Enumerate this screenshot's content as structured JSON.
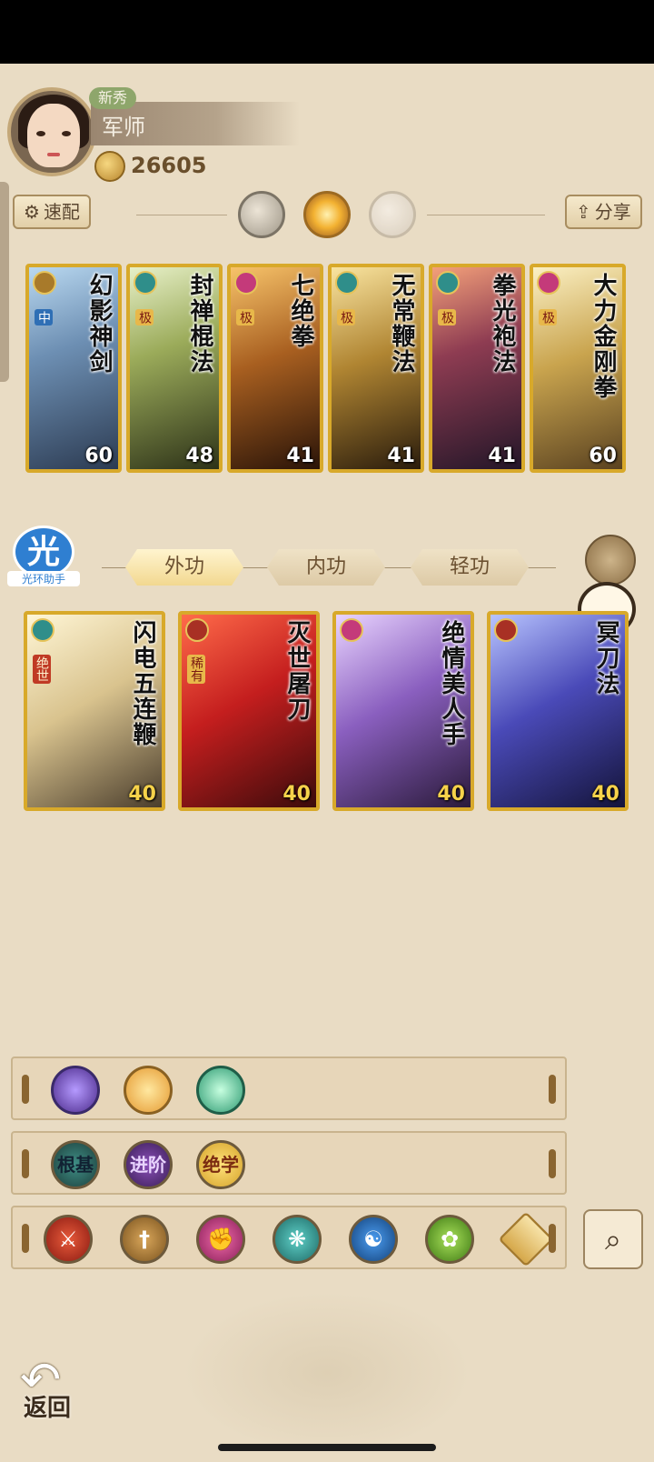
{
  "player": {
    "rank_tag": "新秀",
    "name": "军师",
    "coins": "26605"
  },
  "toolbar": {
    "quick_config_label": "速配",
    "share_label": "分享"
  },
  "equipped_skills": [
    {
      "title": "幻影神剑",
      "level": "60",
      "grade": "中"
    },
    {
      "title": "封禅棍法",
      "level": "48",
      "grade": "极"
    },
    {
      "title": "七绝拳",
      "level": "41",
      "grade": "极"
    },
    {
      "title": "无常鞭法",
      "level": "41",
      "grade": "极"
    },
    {
      "title": "拳光袍法",
      "level": "41",
      "grade": "极"
    },
    {
      "title": "大力金刚拳",
      "level": "60",
      "grade": "极"
    }
  ],
  "helper": {
    "badge": "光",
    "label": "光环助手"
  },
  "categories": {
    "tabs": [
      "外功",
      "内功",
      "轻功"
    ],
    "active": "外功"
  },
  "skill_list": [
    {
      "title": "闪电五连鞭",
      "level": "40",
      "grade": "绝世"
    },
    {
      "title": "灭世屠刀",
      "level": "40",
      "grade": "稀有"
    },
    {
      "title": "绝情美人手",
      "level": "40",
      "grade": ""
    },
    {
      "title": "冥刀法",
      "level": "40",
      "grade": ""
    }
  ],
  "filters": {
    "row2": [
      "根基",
      "进阶",
      "绝学"
    ]
  },
  "back_label": "返回",
  "colors": {
    "background": "#e9dcc4",
    "card_gold": "#d8a92a",
    "active_tab": "#f2d890"
  }
}
